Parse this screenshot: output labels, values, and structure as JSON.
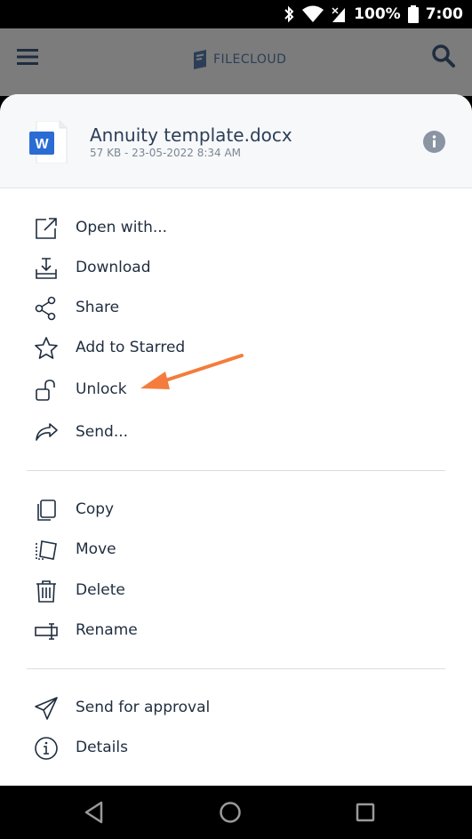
{
  "status_bar": {
    "battery": "100%",
    "time": "7:00"
  },
  "app_bar": {
    "logo_text": "FILECLOUD"
  },
  "file": {
    "name": "Annuity template.docx",
    "meta": "57 KB - 23-05-2022 8:34 AM",
    "type_badge": "W"
  },
  "menu_groups": [
    [
      {
        "label": "Open with...",
        "icon": "open-external-icon"
      },
      {
        "label": "Download",
        "icon": "download-icon"
      },
      {
        "label": "Share",
        "icon": "share-icon"
      },
      {
        "label": "Add to Starred",
        "icon": "star-icon"
      },
      {
        "label": "Unlock",
        "icon": "unlock-icon"
      },
      {
        "label": "Send...",
        "icon": "send-forward-icon"
      }
    ],
    [
      {
        "label": "Copy",
        "icon": "copy-icon"
      },
      {
        "label": "Move",
        "icon": "move-icon"
      },
      {
        "label": "Delete",
        "icon": "trash-icon"
      },
      {
        "label": "Rename",
        "icon": "rename-icon"
      }
    ],
    [
      {
        "label": "Send for approval",
        "icon": "paper-plane-icon"
      },
      {
        "label": "Details",
        "icon": "info-icon"
      }
    ]
  ],
  "colors": {
    "accent_arrow": "#f47c3c",
    "text": "#1f2d3f",
    "word_blue": "#2b6cd4"
  }
}
